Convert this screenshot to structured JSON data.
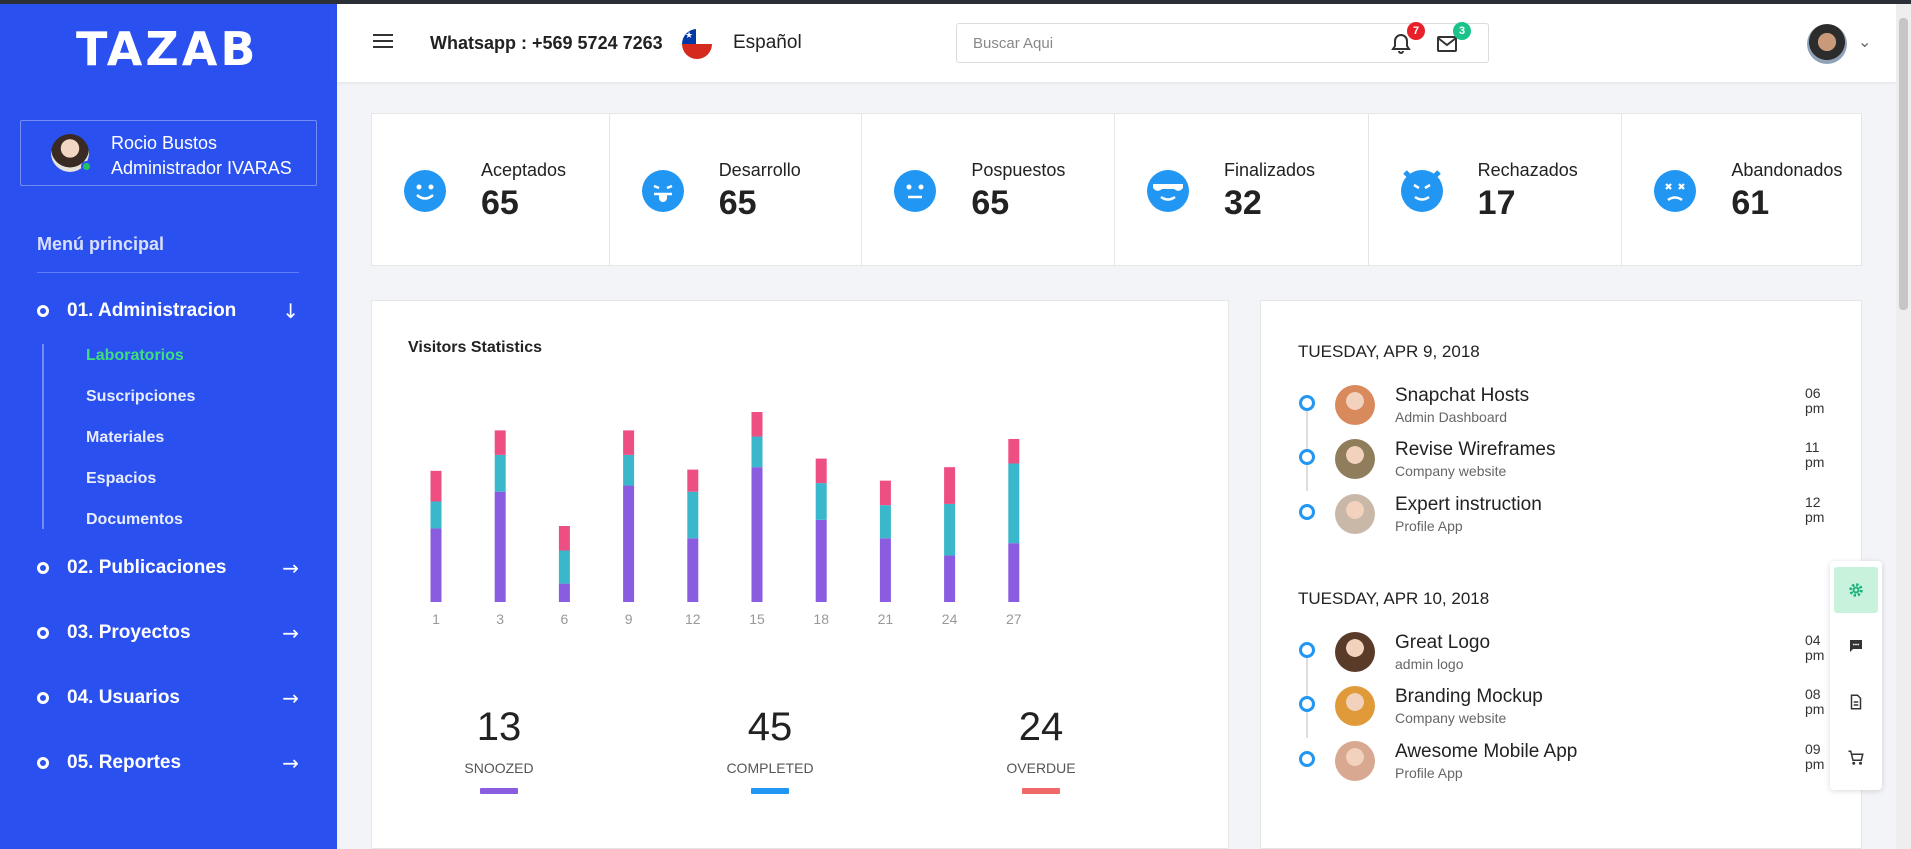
{
  "brand": {
    "logo": "TAZAB"
  },
  "user": {
    "name": "Rocio Bustos",
    "role": "Administrador IVARAS"
  },
  "menu": {
    "title": "Menú principal",
    "items": [
      {
        "label": "01. Administracion",
        "arrow": "↓"
      },
      {
        "label": "02. Publicaciones",
        "arrow": "→"
      },
      {
        "label": "03. Proyectos",
        "arrow": "→"
      },
      {
        "label": "04. Usuarios",
        "arrow": "→"
      },
      {
        "label": "05. Reportes",
        "arrow": "→"
      }
    ],
    "subitems": [
      {
        "label": "Laboratorios",
        "active": true
      },
      {
        "label": "Suscripciones"
      },
      {
        "label": "Materiales"
      },
      {
        "label": "Espacios"
      },
      {
        "label": "Documentos"
      }
    ]
  },
  "header": {
    "whatsapp": "Whatsapp : +569 5724 7263",
    "language": "Español",
    "search_placeholder": "Buscar Aqui",
    "notifications_count": "7",
    "messages_count": "3"
  },
  "stats": [
    {
      "label": "Aceptados",
      "value": "65",
      "icon": "smile-icon"
    },
    {
      "label": "Desarrollo",
      "value": "65",
      "icon": "tongue-face-icon"
    },
    {
      "label": "Pospuestos",
      "value": "65",
      "icon": "neutral-face-icon"
    },
    {
      "label": "Finalizados",
      "value": "32",
      "icon": "sunglasses-face-icon"
    },
    {
      "label": "Rechazados",
      "value": "17",
      "icon": "devil-face-icon"
    },
    {
      "label": "Abandonados",
      "value": "61",
      "icon": "dizzy-face-icon"
    }
  ],
  "visitors": {
    "title": "Visitors Statistics",
    "summary": [
      {
        "value": "13",
        "label": "SNOOZED",
        "color": "#8a5ce0"
      },
      {
        "value": "45",
        "label": "COMPLETED",
        "color": "#2196f3"
      },
      {
        "value": "24",
        "label": "OVERDUE",
        "color": "#f06767"
      }
    ]
  },
  "chart_data": {
    "type": "bar",
    "stacked": true,
    "categories": [
      "1",
      "3",
      "6",
      "9",
      "12",
      "15",
      "18",
      "21",
      "24",
      "27"
    ],
    "series": [
      {
        "values": [
          60,
          90,
          15,
          95,
          52,
          110,
          67,
          52,
          38,
          48
        ],
        "color": "#8a5ce0"
      },
      {
        "values": [
          22,
          30,
          27,
          25,
          38,
          25,
          30,
          27,
          42,
          65
        ],
        "color": "#3ab7cb"
      },
      {
        "values": [
          25,
          20,
          20,
          20,
          18,
          20,
          20,
          20,
          30,
          20
        ],
        "color": "#ee4f82"
      }
    ],
    "ylim": [
      0,
      155
    ]
  },
  "timeline": [
    {
      "date": "TUESDAY, APR 9, 2018",
      "events": [
        {
          "title": "Snapchat Hosts",
          "sub": "Admin Dashboard",
          "time": "06",
          "ampm": "pm",
          "avatar": "#d98a5c"
        },
        {
          "title": "Revise Wireframes",
          "sub": "Company website",
          "time": "11",
          "ampm": "pm",
          "avatar": "#8f7d5b"
        },
        {
          "title": "Expert instruction",
          "sub": "Profile App",
          "time": "12",
          "ampm": "pm",
          "avatar": "#c9b8a8"
        }
      ]
    },
    {
      "date": "TUESDAY, APR 10, 2018",
      "events": [
        {
          "title": "Great Logo",
          "sub": "admin logo",
          "time": "04",
          "ampm": "pm",
          "avatar": "#5a3a28"
        },
        {
          "title": "Branding Mockup",
          "sub": "Company website",
          "time": "08",
          "ampm": "pm",
          "avatar": "#e09a3a"
        },
        {
          "title": "Awesome Mobile App",
          "sub": "Profile App",
          "time": "09",
          "ampm": "pm",
          "avatar": "#d9a890"
        }
      ]
    }
  ],
  "floating_toolbar": [
    {
      "icon": "gear-icon",
      "active": true
    },
    {
      "icon": "chat-icon"
    },
    {
      "icon": "document-icon"
    },
    {
      "icon": "cart-icon"
    }
  ]
}
